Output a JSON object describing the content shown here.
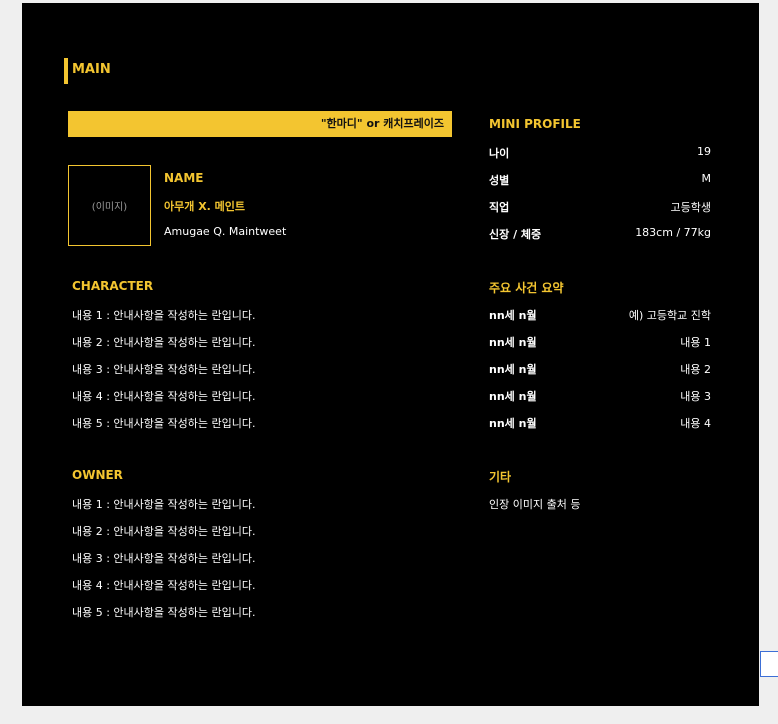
{
  "main": {
    "title": "MAIN"
  },
  "catchphrase": "\"한마디\" or 캐치프레이즈",
  "image_placeholder": "(이미지)",
  "name": {
    "heading": "NAME",
    "korean": "아무개 X. 메인트",
    "english": "Amugae Q. Maintweet"
  },
  "mini_profile": {
    "title": "MINI PROFILE",
    "rows": [
      {
        "key": "나이",
        "value": "19"
      },
      {
        "key": "성별",
        "value": "M"
      },
      {
        "key": "직업",
        "value": "고등학생"
      },
      {
        "key": "신장 / 체중",
        "value": "183cm / 77kg"
      }
    ]
  },
  "character": {
    "title": "CHARACTER",
    "items": [
      "내용 1 : 안내사항을 작성하는 란입니다.",
      "내용 2 : 안내사항을 작성하는 란입니다.",
      "내용 3 : 안내사항을 작성하는 란입니다.",
      "내용 4 : 안내사항을 작성하는 란입니다.",
      "내용 5 : 안내사항을 작성하는 란입니다."
    ]
  },
  "events": {
    "title": "주요 사건 요약",
    "rows": [
      {
        "key": "nn세 n월",
        "value": "예) 고등학교 진학"
      },
      {
        "key": "nn세 n월",
        "value": "내용 1"
      },
      {
        "key": "nn세 n월",
        "value": "내용 2"
      },
      {
        "key": "nn세 n월",
        "value": "내용 3"
      },
      {
        "key": "nn세 n월",
        "value": "내용 4"
      }
    ]
  },
  "owner": {
    "title": "OWNER",
    "items": [
      "내용 1 : 안내사항을 작성하는 란입니다.",
      "내용 2 : 안내사항을 작성하는 란입니다.",
      "내용 3 : 안내사항을 작성하는 란입니다.",
      "내용 4 : 안내사항을 작성하는 란입니다.",
      "내용 5 : 안내사항을 작성하는 란입니다."
    ]
  },
  "etc": {
    "title": "기타",
    "text": "인장 이미지 출처 등"
  },
  "colors": {
    "accent": "#f3c530",
    "background": "#000000",
    "text": "#ffffff"
  }
}
